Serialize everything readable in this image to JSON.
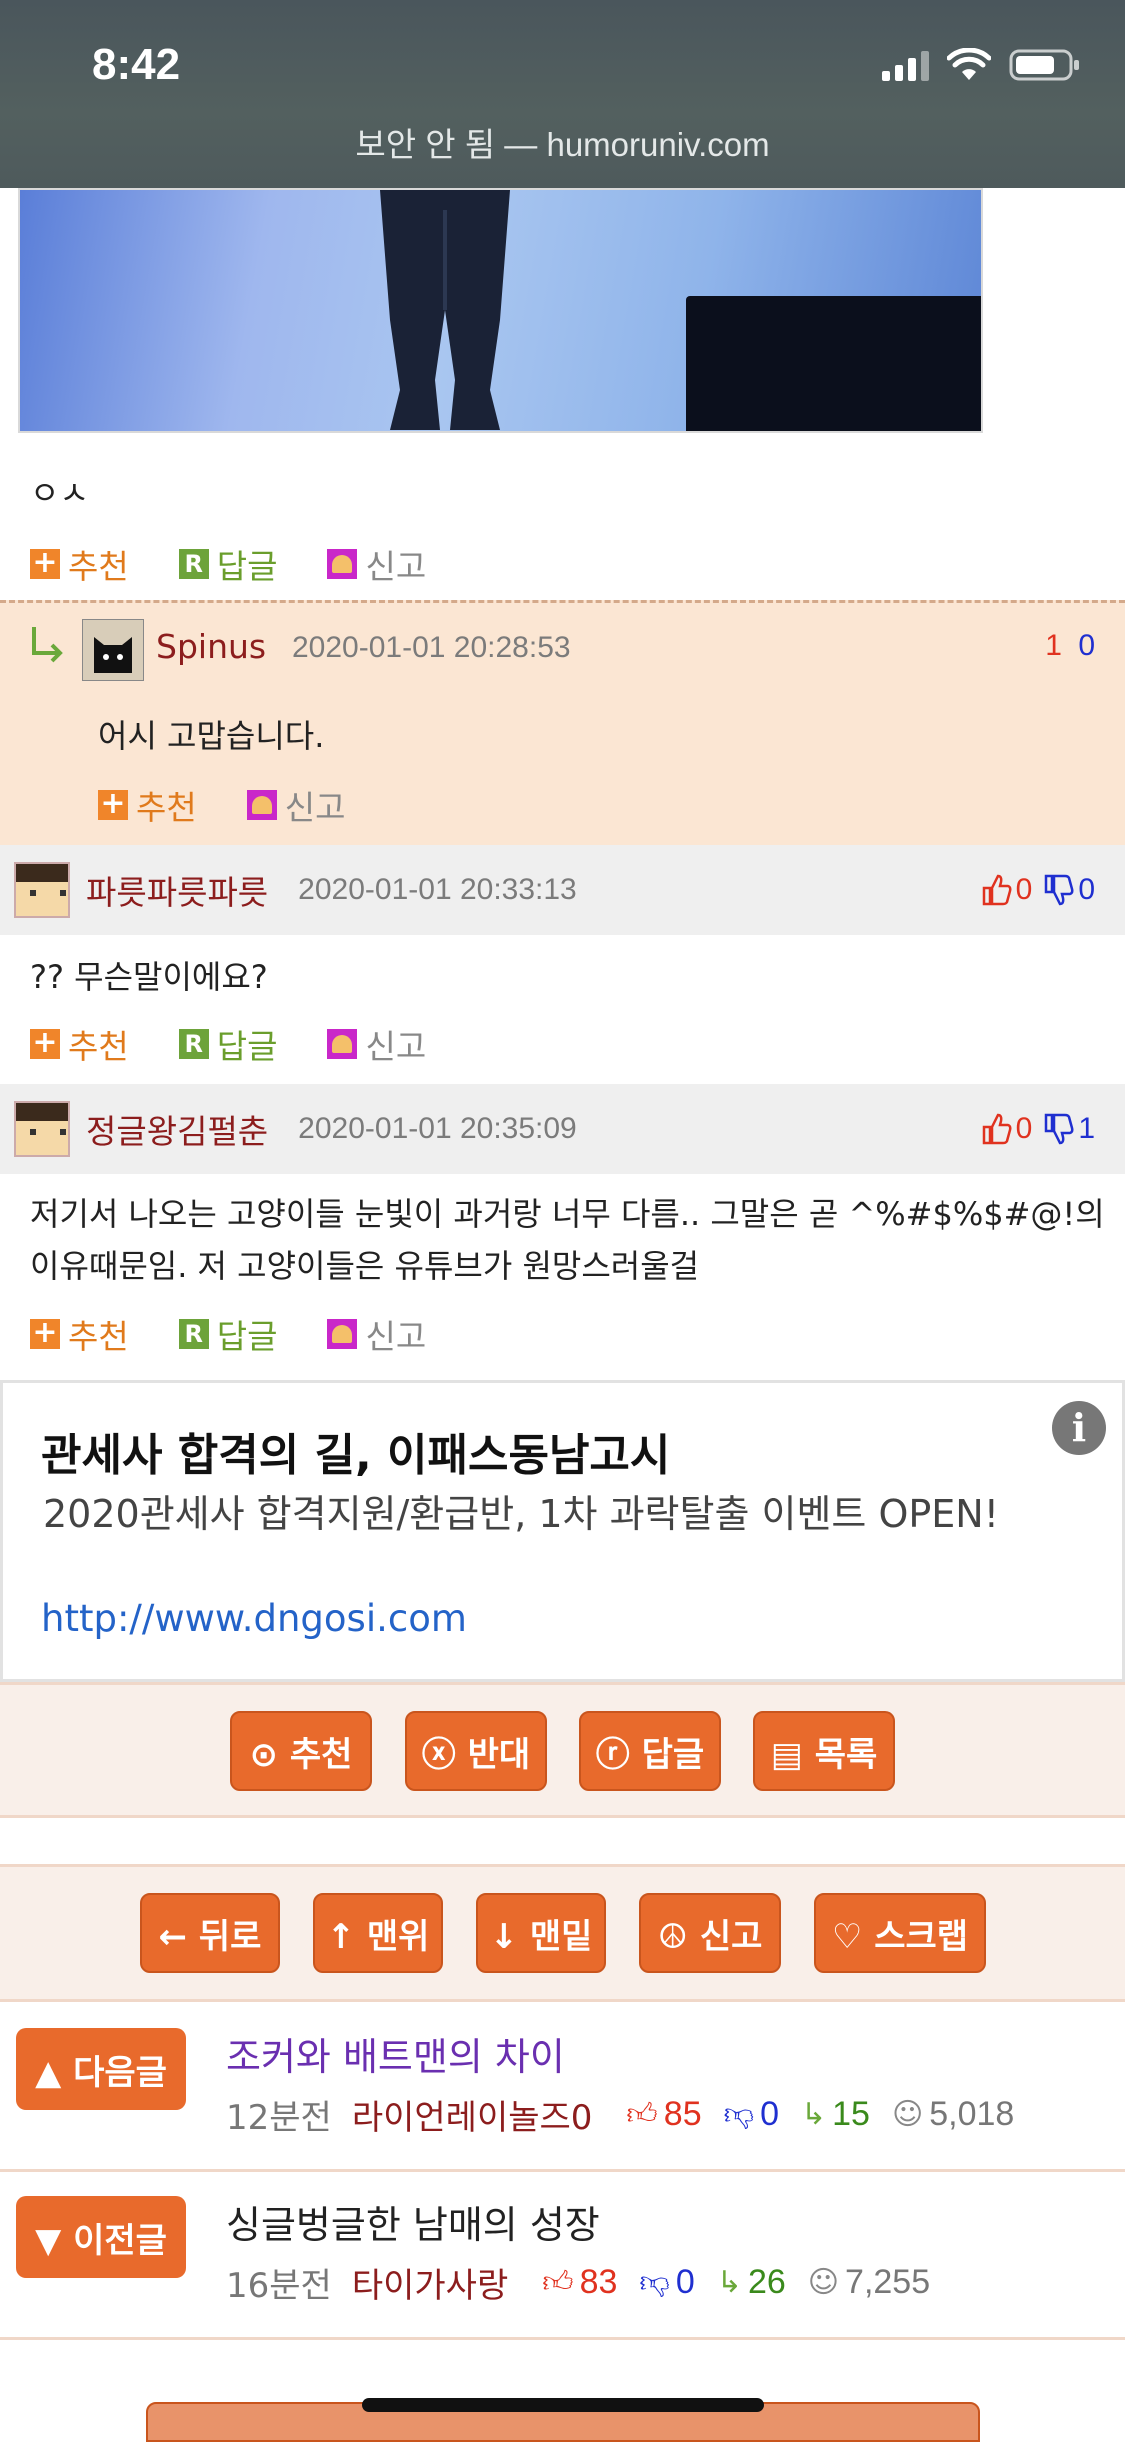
{
  "status_bar": {
    "time": "8:42",
    "url": "보안 안 됨 — humoruniv.com"
  },
  "post": {
    "caption": "ㅇㅅ"
  },
  "labels": {
    "recommend": "추천",
    "reply": "답글",
    "report": "신고"
  },
  "reply_comment": {
    "author": "Spinus",
    "date": "2020-01-01 20:28:53",
    "vote_up": "1",
    "vote_down": "0",
    "text": "어시 고맙습니다."
  },
  "comments": [
    {
      "author": "파릇파릇파릇",
      "date": "2020-01-01 20:33:13",
      "up": "0",
      "down": "0",
      "text": "?? 무슨말이에요?"
    },
    {
      "author": "정글왕김펄춘",
      "date": "2020-01-01 20:35:09",
      "up": "0",
      "down": "1",
      "text": "저기서 나오는 고양이들 눈빛이 과거랑 너무 다름.. 그말은 곧 ^%#$%$#@!의 이유때문임. 저 고양이들은 유튜브가 원망스러울걸"
    }
  ],
  "ad": {
    "title": "관세사 합격의 길, 이패스동남고시",
    "description": "2020관세사 합격지원/환급반, 1차 과락탈출 이벤트 OPEN!",
    "url": "http://www.dngosi.com",
    "info_icon": "i"
  },
  "vote_bar": {
    "recommend": "⊙ 추천",
    "oppose": "ⓧ 반대",
    "reply": "ⓡ 답글",
    "list": "▤ 목록"
  },
  "nav_bar": {
    "back": "← 뒤로",
    "top": "↑ 맨위",
    "bottom": "↓ 맨밑",
    "report": "☮ 신고",
    "scrap": "♡ 스크랩"
  },
  "next_post": {
    "button": "▲ 다음글",
    "title": "조커와 배트맨의 차이",
    "ago": "12분전",
    "author": "라이언레이놀즈0",
    "likes": "85",
    "dislikes": "0",
    "replies": "15",
    "views": "5,018"
  },
  "prev_post": {
    "button": "▼ 이전글",
    "title": "싱글벙글한 남매의 성장",
    "ago": "16분전",
    "author": "타이가사랑",
    "likes": "83",
    "dislikes": "0",
    "replies": "26",
    "views": "7,255"
  },
  "colors": {
    "accent": "#e86a2c",
    "author": "#8c1d1d",
    "up": "#e0321f",
    "down": "#1f2fd0"
  }
}
